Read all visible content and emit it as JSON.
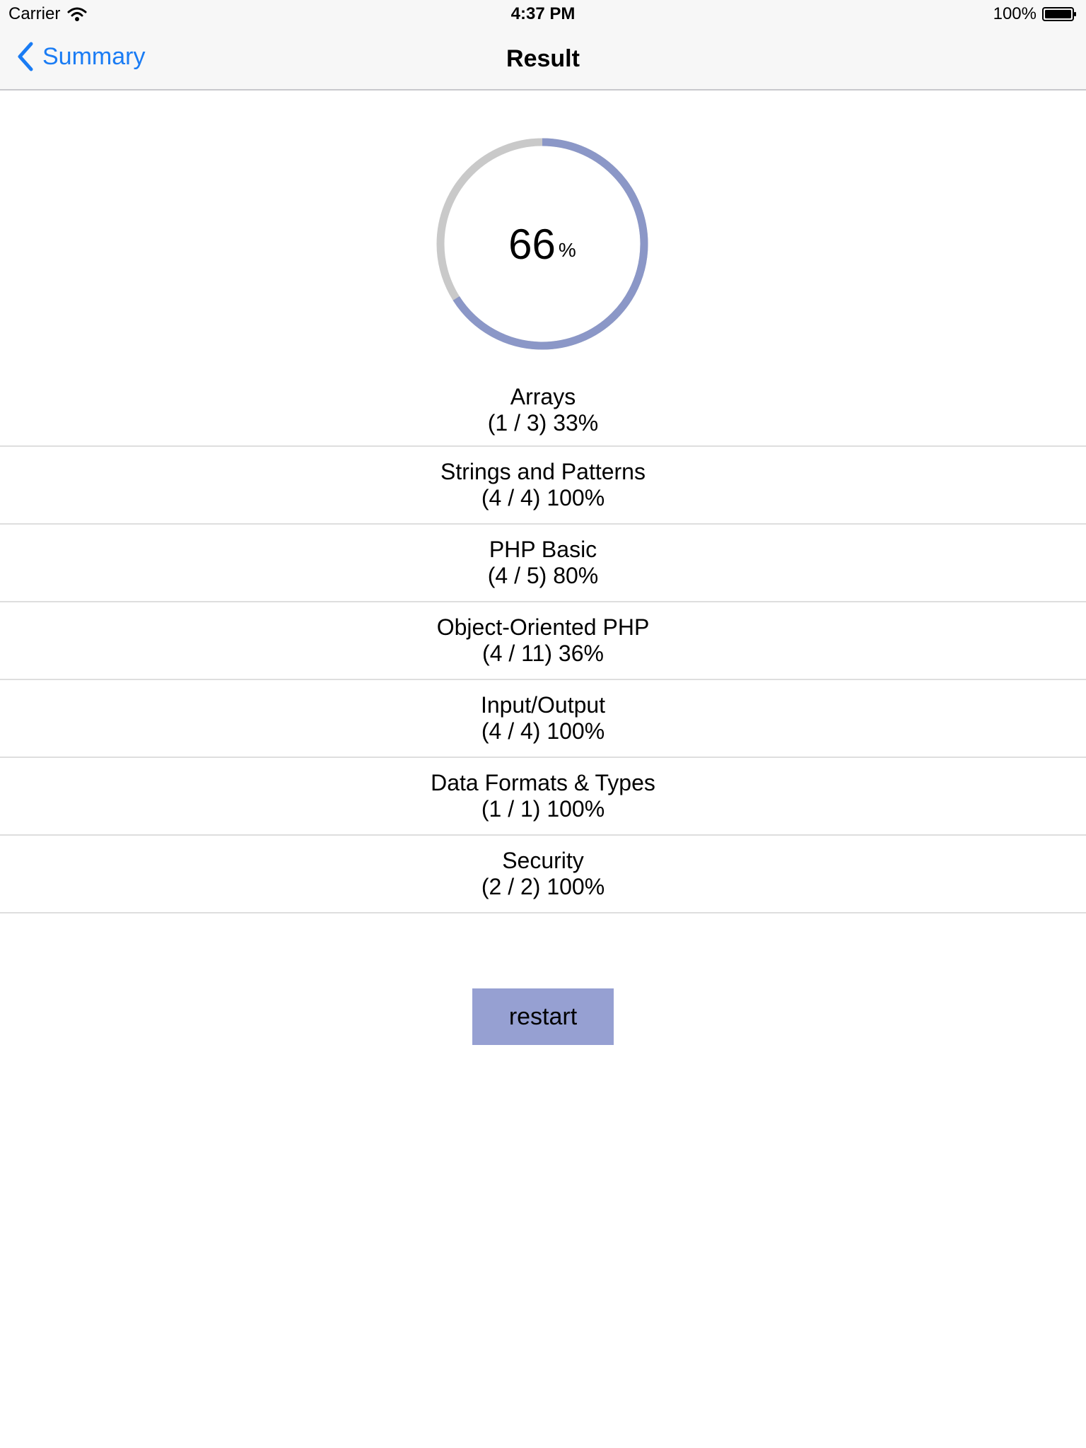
{
  "status_bar": {
    "carrier": "Carrier",
    "time": "4:37 PM",
    "battery": "100%"
  },
  "nav": {
    "back_label": "Summary",
    "title": "Result"
  },
  "score": {
    "value": "66",
    "unit": "%",
    "fraction": 0.66,
    "progress_color": "#8b97c7",
    "track_color": "#c9c9c9"
  },
  "results": [
    {
      "topic": "Arrays",
      "score": "(1 / 3) 33%"
    },
    {
      "topic": "Strings and Patterns",
      "score": "(4 / 4) 100%"
    },
    {
      "topic": "PHP Basic",
      "score": "(4 / 5) 80%"
    },
    {
      "topic": "Object-Oriented PHP",
      "score": "(4 / 11) 36%"
    },
    {
      "topic": "Input/Output",
      "score": "(4 / 4) 100%"
    },
    {
      "topic": "Data Formats & Types",
      "score": "(1 / 1) 100%"
    },
    {
      "topic": "Security",
      "score": "(2 / 2) 100%"
    }
  ],
  "restart_label": "restart",
  "colors": {
    "accent": "#1a7cf4",
    "button": "#96a0d2"
  }
}
